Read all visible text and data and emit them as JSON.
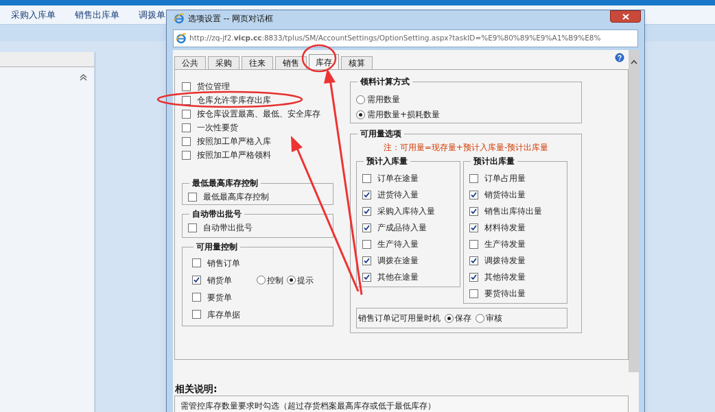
{
  "app_tabs": [
    "采购入库单",
    "销售出库单",
    "调拨单"
  ],
  "dialog": {
    "title": "选项设置 -- 网页对话框",
    "url": "http://zq-jf2.**vicp.cc**:8833/tplus/SM/AccountSettings/OptionSetting.aspx?taskID=%E9%80%89%E9%A1%B9%E8%",
    "tabs": [
      {
        "label": "公共",
        "selected": false
      },
      {
        "label": "采购",
        "selected": false
      },
      {
        "label": "往来",
        "selected": false
      },
      {
        "label": "销售",
        "selected": false
      },
      {
        "label": "库存",
        "selected": true
      },
      {
        "label": "核算",
        "selected": false
      }
    ],
    "left_options": [
      {
        "label": "货位管理",
        "checked": false
      },
      {
        "label": "仓库允许零库存出库",
        "checked": false
      },
      {
        "label": "按仓库设置最高、最低、安全库存",
        "checked": false
      },
      {
        "label": "一次性要货",
        "checked": false
      },
      {
        "label": "按照加工单严格入库",
        "checked": false
      },
      {
        "label": "按照加工单严格领料",
        "checked": false
      }
    ],
    "left_groups": [
      {
        "title": "最低最高库存控制",
        "items": [
          {
            "label": "最低最高库存控制",
            "checked": false
          }
        ]
      },
      {
        "title": "自动带出批号",
        "items": [
          {
            "label": "自动带出批号",
            "checked": false
          }
        ]
      }
    ],
    "availability_control": {
      "title": "可用量控制",
      "items": [
        {
          "label": "销售订单",
          "checked": false
        },
        {
          "label": "销货单",
          "checked": true,
          "modes": [
            {
              "label": "控制",
              "selected": false
            },
            {
              "label": "提示",
              "selected": true
            }
          ]
        },
        {
          "label": "要货单",
          "checked": false
        },
        {
          "label": "库存单据",
          "checked": false
        }
      ]
    },
    "material_calc": {
      "title": "领料计算方式",
      "options": [
        {
          "label": "需用数量",
          "selected": false
        },
        {
          "label": "需用数量+损耗数量",
          "selected": true
        }
      ]
    },
    "availability_options": {
      "title": "可用量选项",
      "note": "注：可用量=现存量+预计入库量-预计出库量",
      "incoming": {
        "title": "预计入库量",
        "items": [
          {
            "label": "订单在途量",
            "checked": false
          },
          {
            "label": "进货待入量",
            "checked": true
          },
          {
            "label": "采购入库待入量",
            "checked": true
          },
          {
            "label": "产成品待入量",
            "checked": true
          },
          {
            "label": "生产待入量",
            "checked": false
          },
          {
            "label": "调拨在途量",
            "checked": true
          },
          {
            "label": "其他在途量",
            "checked": true
          }
        ]
      },
      "outgoing": {
        "title": "预计出库量",
        "items": [
          {
            "label": "订单占用量",
            "checked": false
          },
          {
            "label": "销货待出量",
            "checked": true
          },
          {
            "label": "销售出库待出量",
            "checked": true
          },
          {
            "label": "材料待发量",
            "checked": true
          },
          {
            "label": "生产待发量",
            "checked": false
          },
          {
            "label": "调拨待发量",
            "checked": true
          },
          {
            "label": "其他待发量",
            "checked": true
          },
          {
            "label": "要货待出量",
            "checked": false
          }
        ]
      },
      "timing": {
        "label": "销售订单记可用量时机",
        "options": [
          {
            "label": "保存",
            "selected": true
          },
          {
            "label": "审核",
            "selected": false
          }
        ]
      }
    },
    "description": {
      "title": "相关说明:",
      "text": "需管控库存数量要求时勾选（超过存货档案最高库存或低于最低库存）"
    }
  }
}
